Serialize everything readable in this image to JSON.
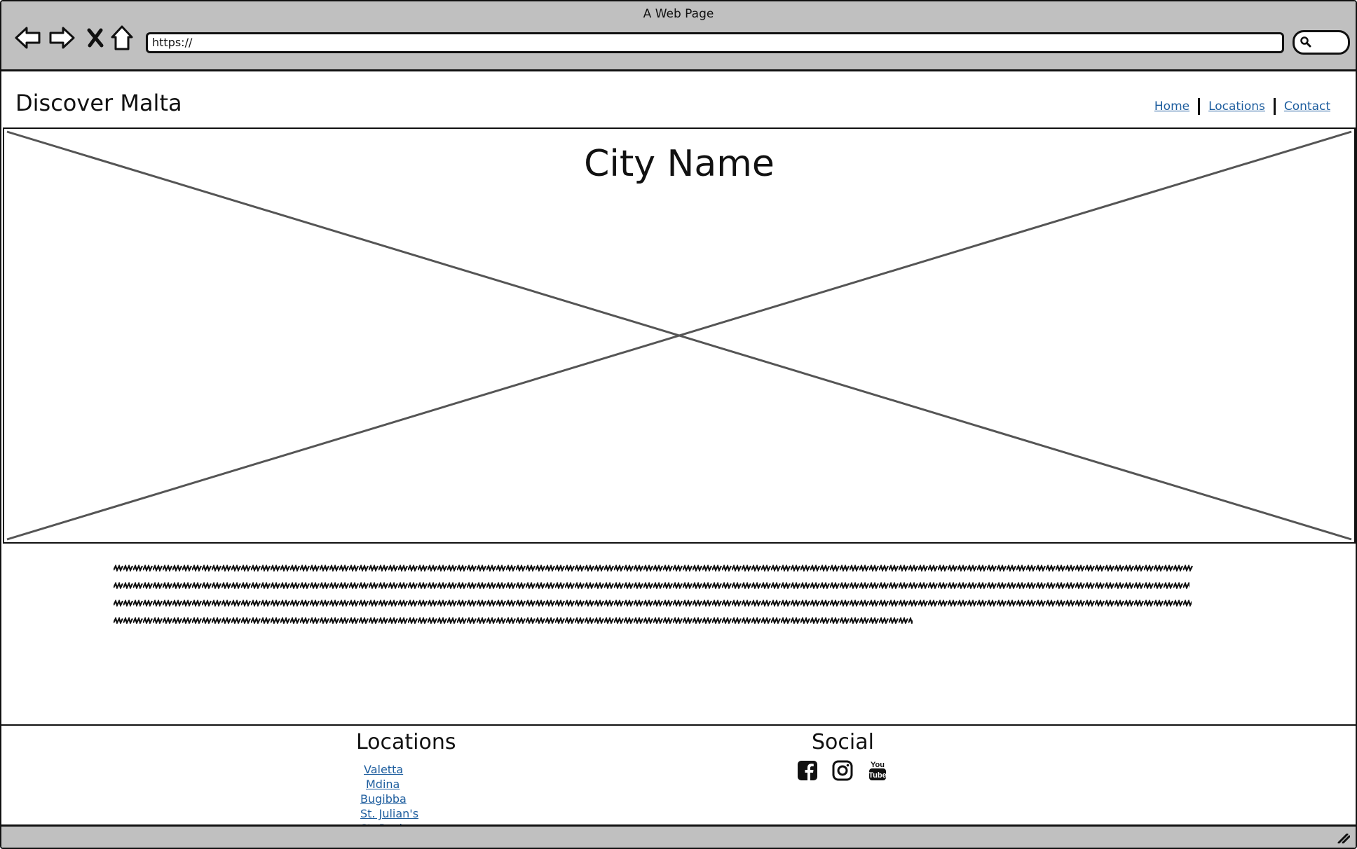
{
  "browser": {
    "window_title": "A Web Page",
    "url": "https://"
  },
  "header": {
    "site_title": "Discover Malta",
    "nav": [
      {
        "label": "Home"
      },
      {
        "label": "Locations"
      },
      {
        "label": "Contact"
      }
    ]
  },
  "hero": {
    "title": "City Name"
  },
  "footer": {
    "locations_heading": "Locations",
    "locations": [
      "Valetta",
      "Mdina",
      "Bugibba",
      "St. Julian's",
      "St. Pauls"
    ],
    "social_heading": "Social",
    "social_icons": [
      "facebook-icon",
      "instagram-icon",
      "youtube-icon"
    ]
  },
  "colors": {
    "chrome": "#c0c0c0",
    "link": "#1d5d9e"
  }
}
